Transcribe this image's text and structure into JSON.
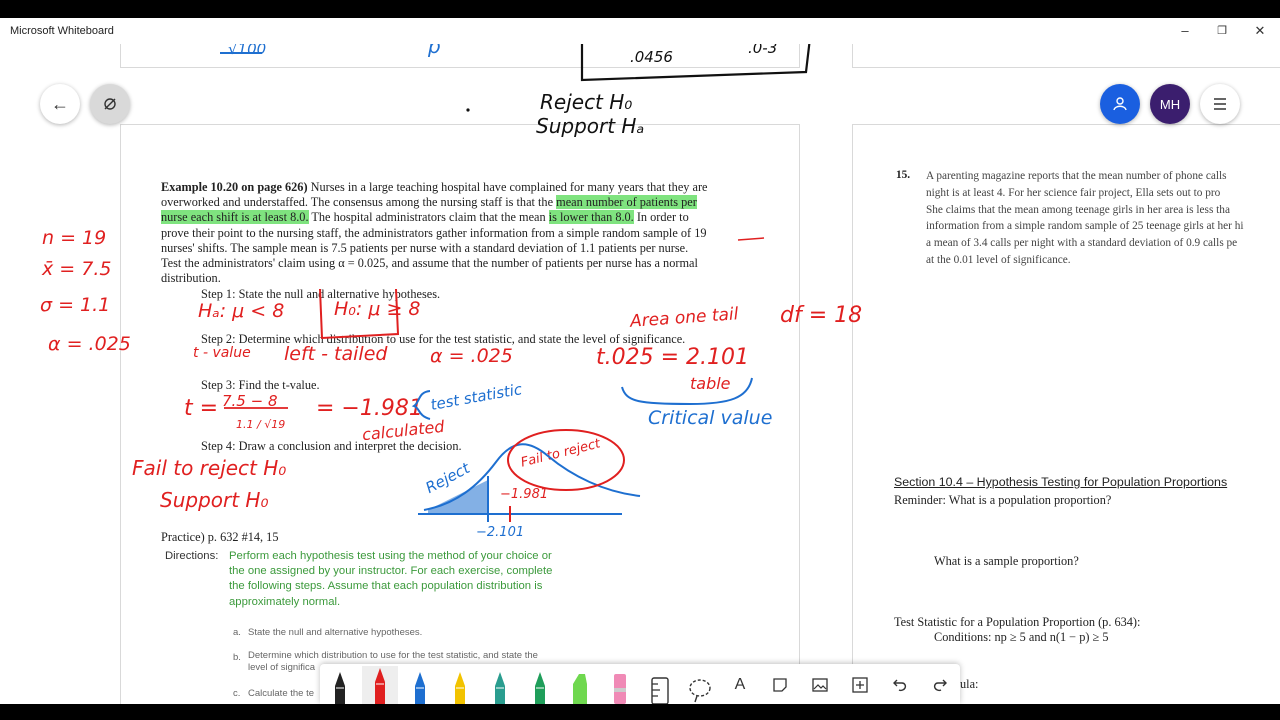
{
  "app": {
    "title": "Microsoft Whiteboard",
    "colors": {
      "ink_red": "#e02020",
      "ink_blue": "#1e6fd0",
      "highlight": "#7fe37f",
      "invite": "#1a5fe0",
      "avatar": "#3b1e6e"
    }
  },
  "window_controls": {
    "minimize": "–",
    "restore": "❐",
    "close": "✕"
  },
  "top_nav": {
    "back_icon": "arrow-left-icon",
    "reading_icon": "reading-mode-icon"
  },
  "top_right": {
    "invite_icon": "person-add-icon",
    "avatar_initials": "MH",
    "menu_icon": "hamburger-menu-icon"
  },
  "ink_top": {
    "denominator": "√100",
    "symbol": "p",
    "value1": ".0456",
    "value2": ".0‑3",
    "line1": "Reject  H₀",
    "line2": "Support  Hₐ"
  },
  "example": {
    "title": "Example 10.20 on page 626)",
    "line1": " Nurses in a large teaching hospital have complained for many years that they are",
    "line2a": "overworked and understaffed.  The consensus among the nursing staff is that the ",
    "line2b": "mean number of patients per",
    "line3a": "nurse each shift is at least 8.0.",
    "line3b": "  The hospital administrators claim that the mean ",
    "line3c": "is lower than 8.0.",
    "line3d": "  In order to",
    "line4": "prove their point to the nursing staff, the administrators gather information from a simple random sample of 19",
    "line5": "nurses' shifts.  The sample mean is 7.5 patients per nurse with a standard deviation of 1.1 patients per nurse.",
    "line6": "Test the administrators' claim using α = 0.025, and assume that the number of patients per nurse has a normal",
    "line7": "distribution.",
    "step1": "Step 1: State the null and alternative hypotheses.",
    "step2": "Step 2: Determine which distribution to use for the test statistic, and state the level of significance.",
    "step3": "Step 3:  Find the t-value.",
    "step4": "Step 4:  Draw a conclusion and interpret the decision."
  },
  "practice": {
    "title": "Practice) p. 632 #14, 15",
    "directions_label": "Directions:",
    "directions_text": [
      "Perform each hypothesis test using the method of your choice or",
      "the one assigned by your instructor.  For each exercise, complete",
      "the following steps.  Assume that each population distribution is",
      "approximately normal."
    ],
    "item_a_label": "a.",
    "item_a": "State the null and alternative hypotheses.",
    "item_b_label": "b.",
    "item_b1": "Determine which distribution to use for the test statistic, and state the",
    "item_b2": "level of significa",
    "item_c_label": "c.",
    "item_c": "Calculate the te"
  },
  "problem15": {
    "number": "15.",
    "lines": [
      "A parenting magazine reports that the mean number of phone calls",
      "night is at least 4.  For her science fair project, Ella sets out to pro",
      "She claims that the mean among teenage girls in her area is less tha",
      "information from a simple random sample of 25 teenage girls at her hi",
      "a mean of 3.4 calls per night with a standard deviation of 0.9 calls pe",
      "at the 0.01 level of significance."
    ]
  },
  "section": {
    "heading": "Section 10.4 – Hypothesis Testing for Population Proportions",
    "reminder": "Reminder:  What is a population proportion?",
    "sample_q": "What is a sample proportion?",
    "test_stat": "Test Statistic for a Population Proportion (p. 634):",
    "conditions": "Conditions:  np ≥ 5 and n(1 − p) ≥ 5",
    "formula_tail": "ula:"
  },
  "ink_notes": {
    "n": "n = 19",
    "xbar": "x̄ = 7.5",
    "sigma": "σ = 1.1",
    "alpha": "α = .025",
    "ha": "Hₐ: μ < 8",
    "h0": "H₀: μ ≥ 8",
    "area": "Area one tail",
    "df": "df = 18",
    "tvalue": "t - value",
    "left": "left - tailed",
    "alpha2": "α = .025",
    "tcrit": "t.025 = 2.101",
    "table": "table",
    "critical": "Critical  value",
    "t_eq": "t = ",
    "frac_num": "7.5 − 8",
    "frac_den": "1.1 / √19",
    "t_result": "= −1.981",
    "test_stat": "test statistic",
    "calculated": "calculated",
    "fail": "Fail to reject H₀",
    "support": "Support H₀",
    "reject_label": "Reject",
    "fail_label": "Fail to reject",
    "axis_t": "−1.981",
    "axis_crit": "−2.101"
  },
  "toolbar": {
    "tools": [
      "black-pen-icon",
      "red-pen-icon",
      "blue-pen-icon",
      "yellow-pen-icon",
      "teal-pen-icon",
      "green-pen-icon",
      "green-highlighter-icon",
      "pink-eraser-icon",
      "ruler-icon",
      "lasso-icon",
      "text-icon",
      "sticky-note-icon",
      "image-icon",
      "add-icon",
      "undo-icon",
      "redo-icon"
    ],
    "text_tool": "A",
    "add_label": "+"
  }
}
